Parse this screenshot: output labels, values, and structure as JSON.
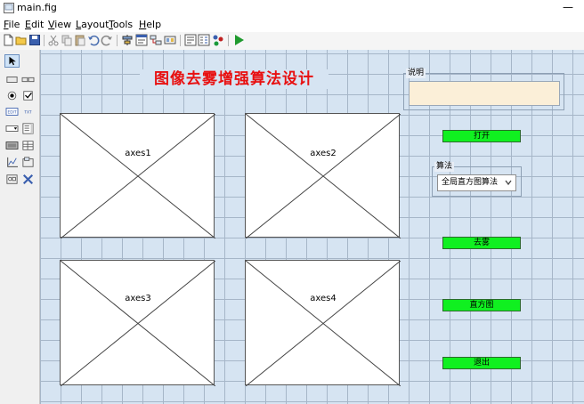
{
  "window": {
    "title": "main.fig"
  },
  "menu": [
    {
      "key": "F",
      "rest": "ile"
    },
    {
      "key": "E",
      "rest": "dit"
    },
    {
      "key": "V",
      "rest": "iew"
    },
    {
      "key": "L",
      "rest": "ayout"
    },
    {
      "key": "T",
      "rest": "ools"
    },
    {
      "key": "H",
      "rest": "elp"
    }
  ],
  "figure": {
    "title": "图像去雾增强算法设计",
    "axes": [
      "axes1",
      "axes2",
      "axes3",
      "axes4"
    ],
    "description_panel": {
      "title": "说明",
      "value": ""
    },
    "algorithm_panel": {
      "title": "算法",
      "selected": "全局直方图算法"
    },
    "buttons": {
      "open": "打开",
      "dehaze": "去雾",
      "histogram": "直方图",
      "exit": "退出"
    }
  },
  "colors": {
    "canvas": "#d6e4f2",
    "grid": "#a6b6c8",
    "title_text": "#e81010",
    "button_green": "#10f020",
    "edit_bg": "#fbefd8"
  },
  "icons": {
    "toolbar": [
      "new-file-icon",
      "open-folder-icon",
      "save-icon",
      "cut-icon",
      "copy-icon",
      "paste-icon",
      "undo-icon",
      "redo-icon",
      "align-icon",
      "menu-editor-icon",
      "tab-order-icon",
      "toolbar-editor-icon",
      "m-file-editor-icon",
      "property-inspector-icon",
      "object-browser-icon",
      "run-icon"
    ],
    "palette": [
      "select-arrow-icon",
      "push-button-icon",
      "slider-icon",
      "radio-button-icon",
      "checkbox-icon",
      "edit-text-icon",
      "static-text-icon",
      "popup-menu-icon",
      "listbox-icon",
      "toggle-button-icon",
      "table-icon",
      "axes-icon",
      "panel-icon",
      "button-group-icon",
      "activex-icon"
    ]
  }
}
